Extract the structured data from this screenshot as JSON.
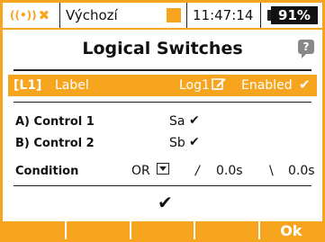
{
  "statusbar": {
    "model_name": "Výchozí",
    "time": "11:47:14",
    "battery": "91%"
  },
  "title": "Logical Switches",
  "help_icon_text": "?",
  "selected_row": {
    "id": "[L1]",
    "label": "Label",
    "log": "Log1",
    "enabled": "Enabled",
    "check": "✔"
  },
  "controls": {
    "a_label": "A) Control 1",
    "a_value": "Sa",
    "a_check": "✔",
    "b_label": "B) Control 2",
    "b_value": "Sb",
    "b_check": "✔"
  },
  "condition": {
    "label": "Condition",
    "value": "OR",
    "rise_symbol": "/",
    "rise_time": "0.0s",
    "fall_symbol": "\\",
    "fall_time": "0.0s"
  },
  "confirm_check": "✔",
  "footer": {
    "ok_label": "Ok"
  },
  "colors": {
    "accent": "#f7a51e",
    "text": "#111111",
    "background": "#ffffff"
  }
}
